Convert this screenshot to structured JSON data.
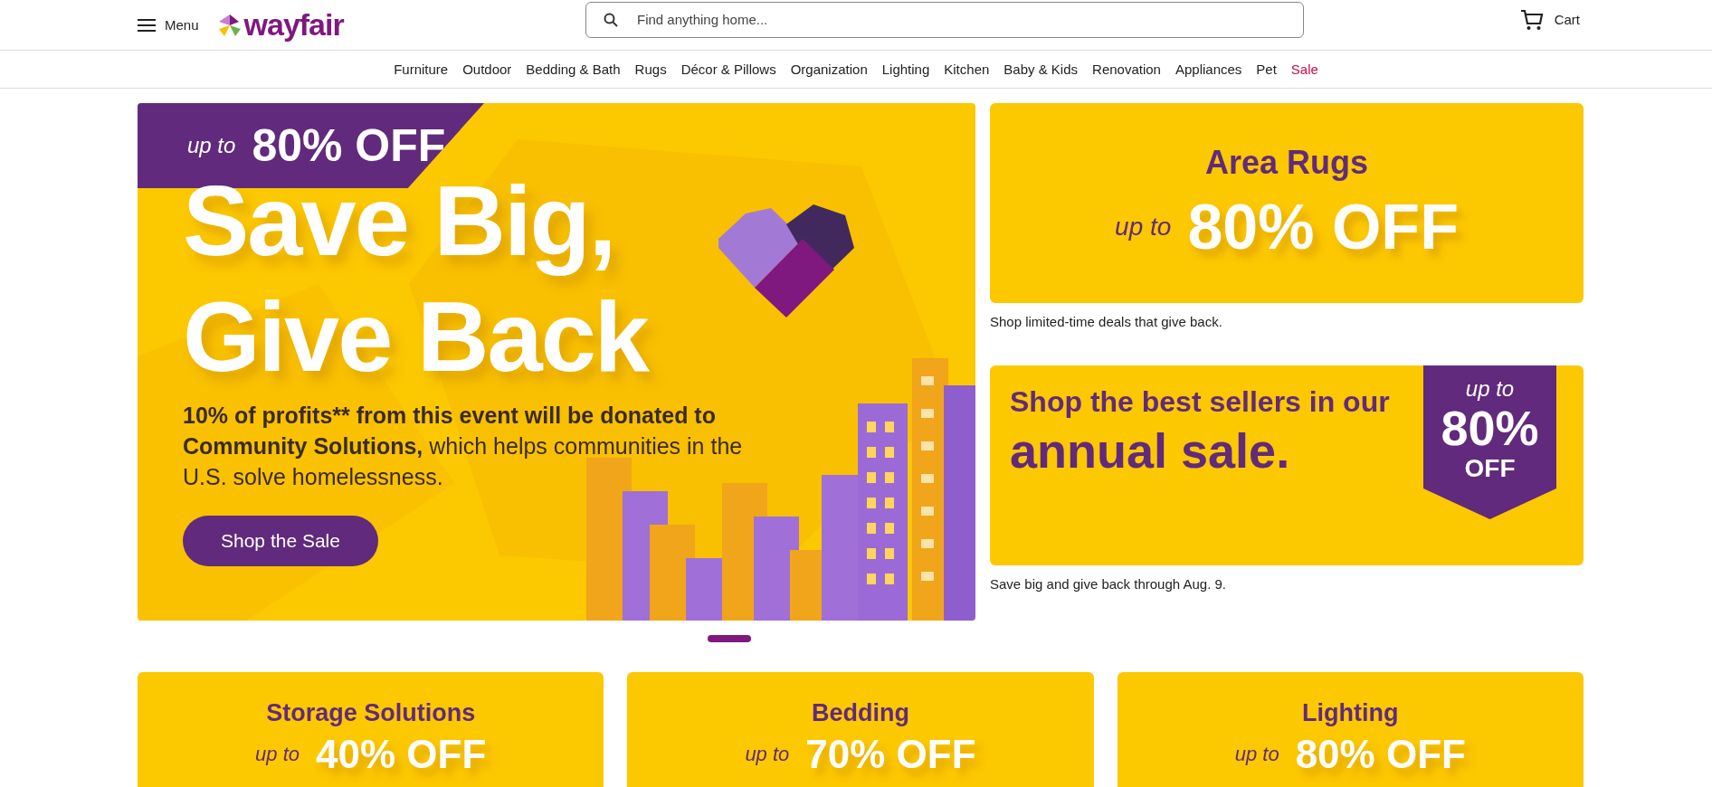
{
  "header": {
    "menu_label": "Menu",
    "logo": "wayfair",
    "search": {
      "placeholder": "Find anything home..."
    },
    "cart_label": "Cart"
  },
  "nav": [
    {
      "label": "Furniture",
      "kind": "link"
    },
    {
      "label": "Outdoor",
      "kind": "link"
    },
    {
      "label": "Bedding & Bath",
      "kind": "link"
    },
    {
      "label": "Rugs",
      "kind": "link"
    },
    {
      "label": "Décor & Pillows",
      "kind": "link"
    },
    {
      "label": "Organization",
      "kind": "link"
    },
    {
      "label": "Lighting",
      "kind": "link"
    },
    {
      "label": "Kitchen",
      "kind": "link"
    },
    {
      "label": "Baby & Kids",
      "kind": "link"
    },
    {
      "label": "Renovation",
      "kind": "link"
    },
    {
      "label": "Appliances",
      "kind": "link"
    },
    {
      "label": "Pet",
      "kind": "link"
    },
    {
      "label": "Sale",
      "kind": "sale"
    }
  ],
  "hero": {
    "tag_prefix": "up to",
    "tag_value": "80% OFF",
    "headline": [
      "Save Big,",
      "Give Back"
    ],
    "body_bold": "10% of profits** from this event will be donated to Community Solutions,",
    "body_rest": "which helps communities in the U.S. solve homelessness.",
    "button": "Shop the Sale"
  },
  "carousel_dots": [
    {
      "selected": true
    }
  ],
  "promos": [
    {
      "kind": "title",
      "title": "Area Rugs",
      "prefix": "up to",
      "value": "80% OFF",
      "caption": "Shop limited-time deals that give back."
    },
    {
      "kind": "badge",
      "line_1": "Shop the best sellers in our",
      "line_2": "annual sale.",
      "badge_prefix": "up to",
      "badge_value": "80%",
      "badge_suffix": "OFF",
      "caption": "Save big and give back through Aug. 9."
    }
  ],
  "categories": [
    {
      "title": "Storage Solutions",
      "prefix": "up to",
      "value": "40% OFF"
    },
    {
      "title": "Bedding",
      "prefix": "up to",
      "value": "70% OFF"
    },
    {
      "title": "Lighting",
      "prefix": "up to",
      "value": "80% OFF"
    }
  ]
}
